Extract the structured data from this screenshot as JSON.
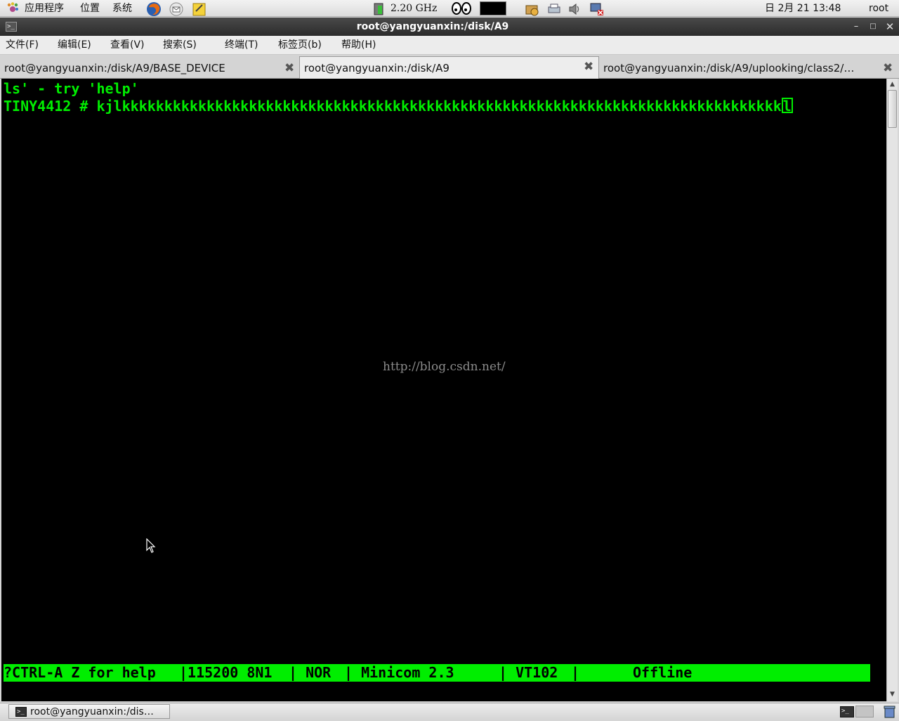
{
  "top_panel": {
    "applications": "应用程序",
    "places": "位置",
    "system": "系统",
    "cpu_freq": "2.20 GHz",
    "date_time": "日 2月 21 13:48",
    "user": "root"
  },
  "window": {
    "title": "root@yangyuanxin:/disk/A9"
  },
  "menubar": {
    "file": "文件(F)",
    "edit": "编辑(E)",
    "view": "查看(V)",
    "search": "搜索(S)",
    "terminal": "终端(T)",
    "tabs": "标签页(b)",
    "help": "帮助(H)"
  },
  "tabs": [
    {
      "label": "root@yangyuanxin:/disk/A9/BASE_DEVICE"
    },
    {
      "label": "root@yangyuanxin:/disk/A9"
    },
    {
      "label": "root@yangyuanxin:/disk/A9/uplooking/class2/…"
    }
  ],
  "terminal": {
    "line1": "ls' - try 'help'",
    "line2_prompt": "TINY4412 # ",
    "line2_input": "kjlkkkkkkkkkkkkkkkkkkkkkkkkkkkkkkkkkkkkkkkkkkkkkkkkkkkkkkkkkkkkkkkkkkkkkkkkkkkkkk",
    "cursor_char": "l",
    "watermark": "http://blog.csdn.net/",
    "status": {
      "help": "?CTRL-A Z for help",
      "baud": "|115200 8N1",
      "mode": "| NOR",
      "app": "| Minicom 2.3",
      "term": "| VT102",
      "sep": "|",
      "state": "Offline"
    }
  },
  "taskbar": {
    "task_label": "root@yangyuanxin:/dis…"
  }
}
